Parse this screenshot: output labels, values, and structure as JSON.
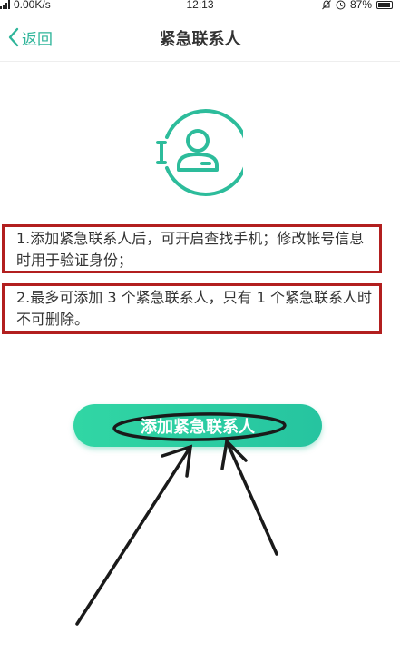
{
  "status_bar": {
    "network_speed": "0.00K/s",
    "time": "12:13",
    "battery": "87%"
  },
  "nav": {
    "back_label": "返回",
    "title": "紧急联系人"
  },
  "info": [
    "1.添加紧急联系人后，可开启查找手机；修改帐号信息时用于验证身份；",
    "2.最多可添加 3 个紧急联系人，只有 1 个紧急联系人时不可删除。"
  ],
  "add_button": {
    "label": "添加紧急联系人"
  },
  "colors": {
    "accent": "#2fb59a",
    "button_gradient_start": "#31d6a4",
    "button_gradient_end": "#26c4a0",
    "annotation_box": "#b21f1f",
    "annotation_ink": "#1a1a1a"
  },
  "icons": {
    "back": "chevron-left-icon",
    "contact": "emergency-contact-icon"
  }
}
